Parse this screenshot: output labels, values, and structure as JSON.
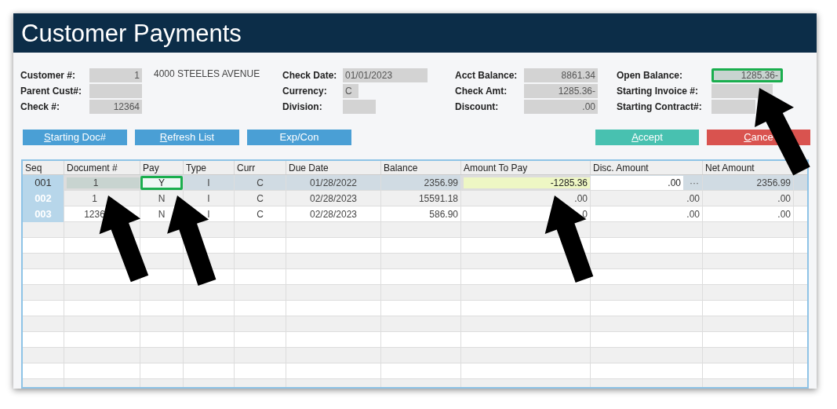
{
  "window": {
    "title": "Customer Payments"
  },
  "form": {
    "groups": [
      {
        "fields": [
          {
            "label": "Customer #:",
            "value": "1",
            "highlighted": false
          },
          {
            "label": "Parent Cust#:",
            "highlighted": false
          },
          {
            "label": "Check #:",
            "value": "12364",
            "highlighted": false
          }
        ],
        "note": "4000 STEELES AVENUE"
      },
      {
        "fields": [
          {
            "label": "Check Date:",
            "value": "01/01/2023",
            "highlighted": false
          },
          {
            "label": "Currency:",
            "value": "C",
            "highlighted": false
          },
          {
            "label": "Division:",
            "highlighted": false
          }
        ]
      },
      {
        "fields": [
          {
            "label": "Acct Balance:",
            "value": "8861.34",
            "highlighted": false
          },
          {
            "label": "Check Amt:",
            "value": "1285.36-",
            "highlighted": false
          },
          {
            "label": "Discount:",
            "value": ".00",
            "highlighted": false
          }
        ]
      },
      {
        "fields": [
          {
            "label": "Open Balance:",
            "value": "1285.36-",
            "highlighted": true
          },
          {
            "label": "Starting Invoice #:",
            "highlighted": false
          },
          {
            "label": "Starting Contract#:",
            "highlighted": false
          }
        ]
      }
    ]
  },
  "buttons_left": [
    {
      "label": "Starting Doc#",
      "hotkey": true
    },
    {
      "label": "Refresh List",
      "hotkey": true
    },
    {
      "label": "Exp/Con",
      "hotkey": false
    }
  ],
  "buttons_right": [
    {
      "label": "Accept",
      "hotkey": true,
      "color": "#48c1b0"
    },
    {
      "label": "Cance",
      "hotkey": true,
      "color": "#d9534f"
    }
  ],
  "table": {
    "columns": [
      "Seq",
      "Document #",
      "Pay",
      "Type",
      "Curr",
      "Due Date",
      "Balance",
      "Amount To Pay",
      "Disc. Amount",
      "Net Amount"
    ],
    "rows": [
      {
        "selected": true,
        "cells": [
          {
            "text": "001",
            "kind": "seq",
            "highlighted": false
          },
          {
            "text": "1",
            "kind": "text",
            "highlighted": true
          },
          {
            "text": "Y",
            "kind": "input",
            "highlighted": true
          },
          {
            "text": "I",
            "kind": "text",
            "highlighted": false
          },
          {
            "text": "C",
            "kind": "text",
            "highlighted": false
          },
          {
            "text": "01/28/2022",
            "kind": "text",
            "highlighted": false
          },
          {
            "text": "2356.99",
            "kind": "text",
            "highlighted": false
          },
          {
            "text": "-1285.36",
            "kind": "edit",
            "highlighted": true
          },
          {
            "text": ".00",
            "kind": "input",
            "highlighted": false,
            "more": "···"
          },
          {
            "text": "2356.99",
            "kind": "text",
            "highlighted": false
          }
        ]
      },
      {
        "selected": false,
        "cells": [
          {
            "text": "002",
            "kind": "seq",
            "highlighted": false
          },
          {
            "text": "1",
            "kind": "text",
            "highlighted": false
          },
          {
            "text": "N",
            "kind": "text",
            "highlighted": false
          },
          {
            "text": "I",
            "kind": "text",
            "highlighted": false
          },
          {
            "text": "C",
            "kind": "text",
            "highlighted": false
          },
          {
            "text": "02/28/2023",
            "kind": "text",
            "highlighted": false
          },
          {
            "text": "15591.18",
            "kind": "text",
            "highlighted": false
          },
          {
            "text": ".00",
            "kind": "text",
            "highlighted": false
          },
          {
            "text": ".00",
            "kind": "text",
            "highlighted": false
          },
          {
            "text": ".00",
            "kind": "text",
            "highlighted": false
          }
        ]
      },
      {
        "selected": false,
        "cells": [
          {
            "text": "003",
            "kind": "seq",
            "highlighted": false
          },
          {
            "text": "1236",
            "kind": "text",
            "highlighted": false
          },
          {
            "text": "N",
            "kind": "text",
            "highlighted": false
          },
          {
            "text": "I",
            "kind": "text",
            "highlighted": false
          },
          {
            "text": "C",
            "kind": "text",
            "highlighted": false
          },
          {
            "text": "02/28/2023",
            "kind": "text",
            "highlighted": false
          },
          {
            "text": "586.90",
            "kind": "text",
            "highlighted": false
          },
          {
            "text": "0",
            "kind": "text",
            "highlighted": false
          },
          {
            "text": ".00",
            "kind": "text",
            "highlighted": false
          },
          {
            "text": ".00",
            "kind": "text",
            "highlighted": false
          }
        ]
      }
    ]
  }
}
